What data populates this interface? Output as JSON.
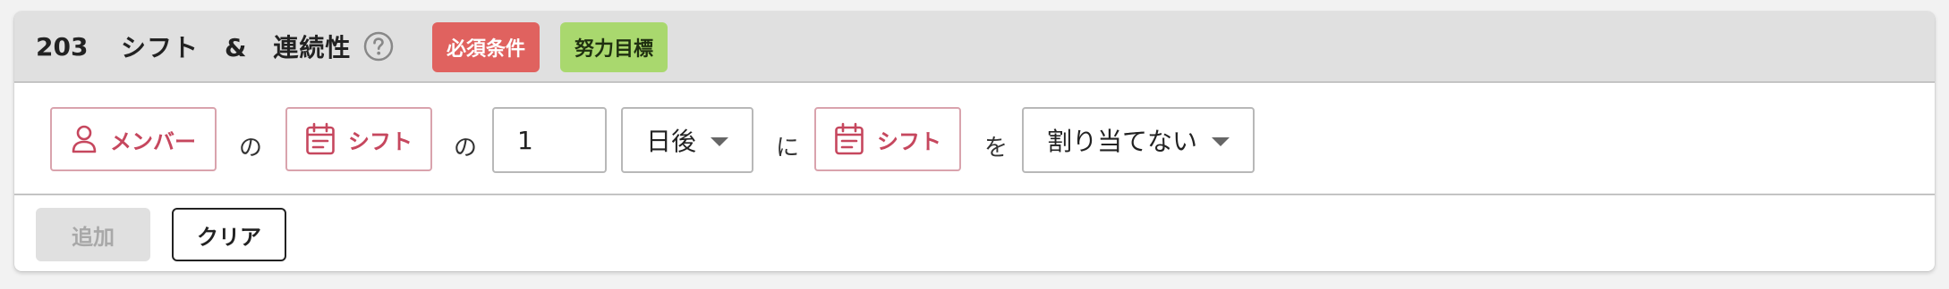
{
  "header": {
    "number": "203",
    "title": "シフト　&　連続性",
    "help_icon": "question-circle-icon",
    "badges": {
      "required": {
        "label": "必須条件",
        "color": "#e0625f",
        "text_color": "#ffffff"
      },
      "effort": {
        "label": "努力目標",
        "color": "#a9d86e",
        "text_color": "#1f2f10"
      }
    }
  },
  "rule": {
    "member_chip": {
      "label": "メンバー",
      "icon": "person-icon"
    },
    "joiner_1": "の",
    "shift_chip_1": {
      "label": "シフト",
      "icon": "calendar-icon"
    },
    "joiner_2": "の",
    "days_value": "1",
    "day_select": {
      "value": "日後"
    },
    "joiner_3": "に",
    "shift_chip_2": {
      "label": "シフト",
      "icon": "calendar-icon"
    },
    "joiner_4": "を",
    "assign_select": {
      "value": "割り当てない"
    },
    "accent_color": "#c6475e"
  },
  "footer": {
    "add_label": "追加",
    "clear_label": "クリア"
  }
}
